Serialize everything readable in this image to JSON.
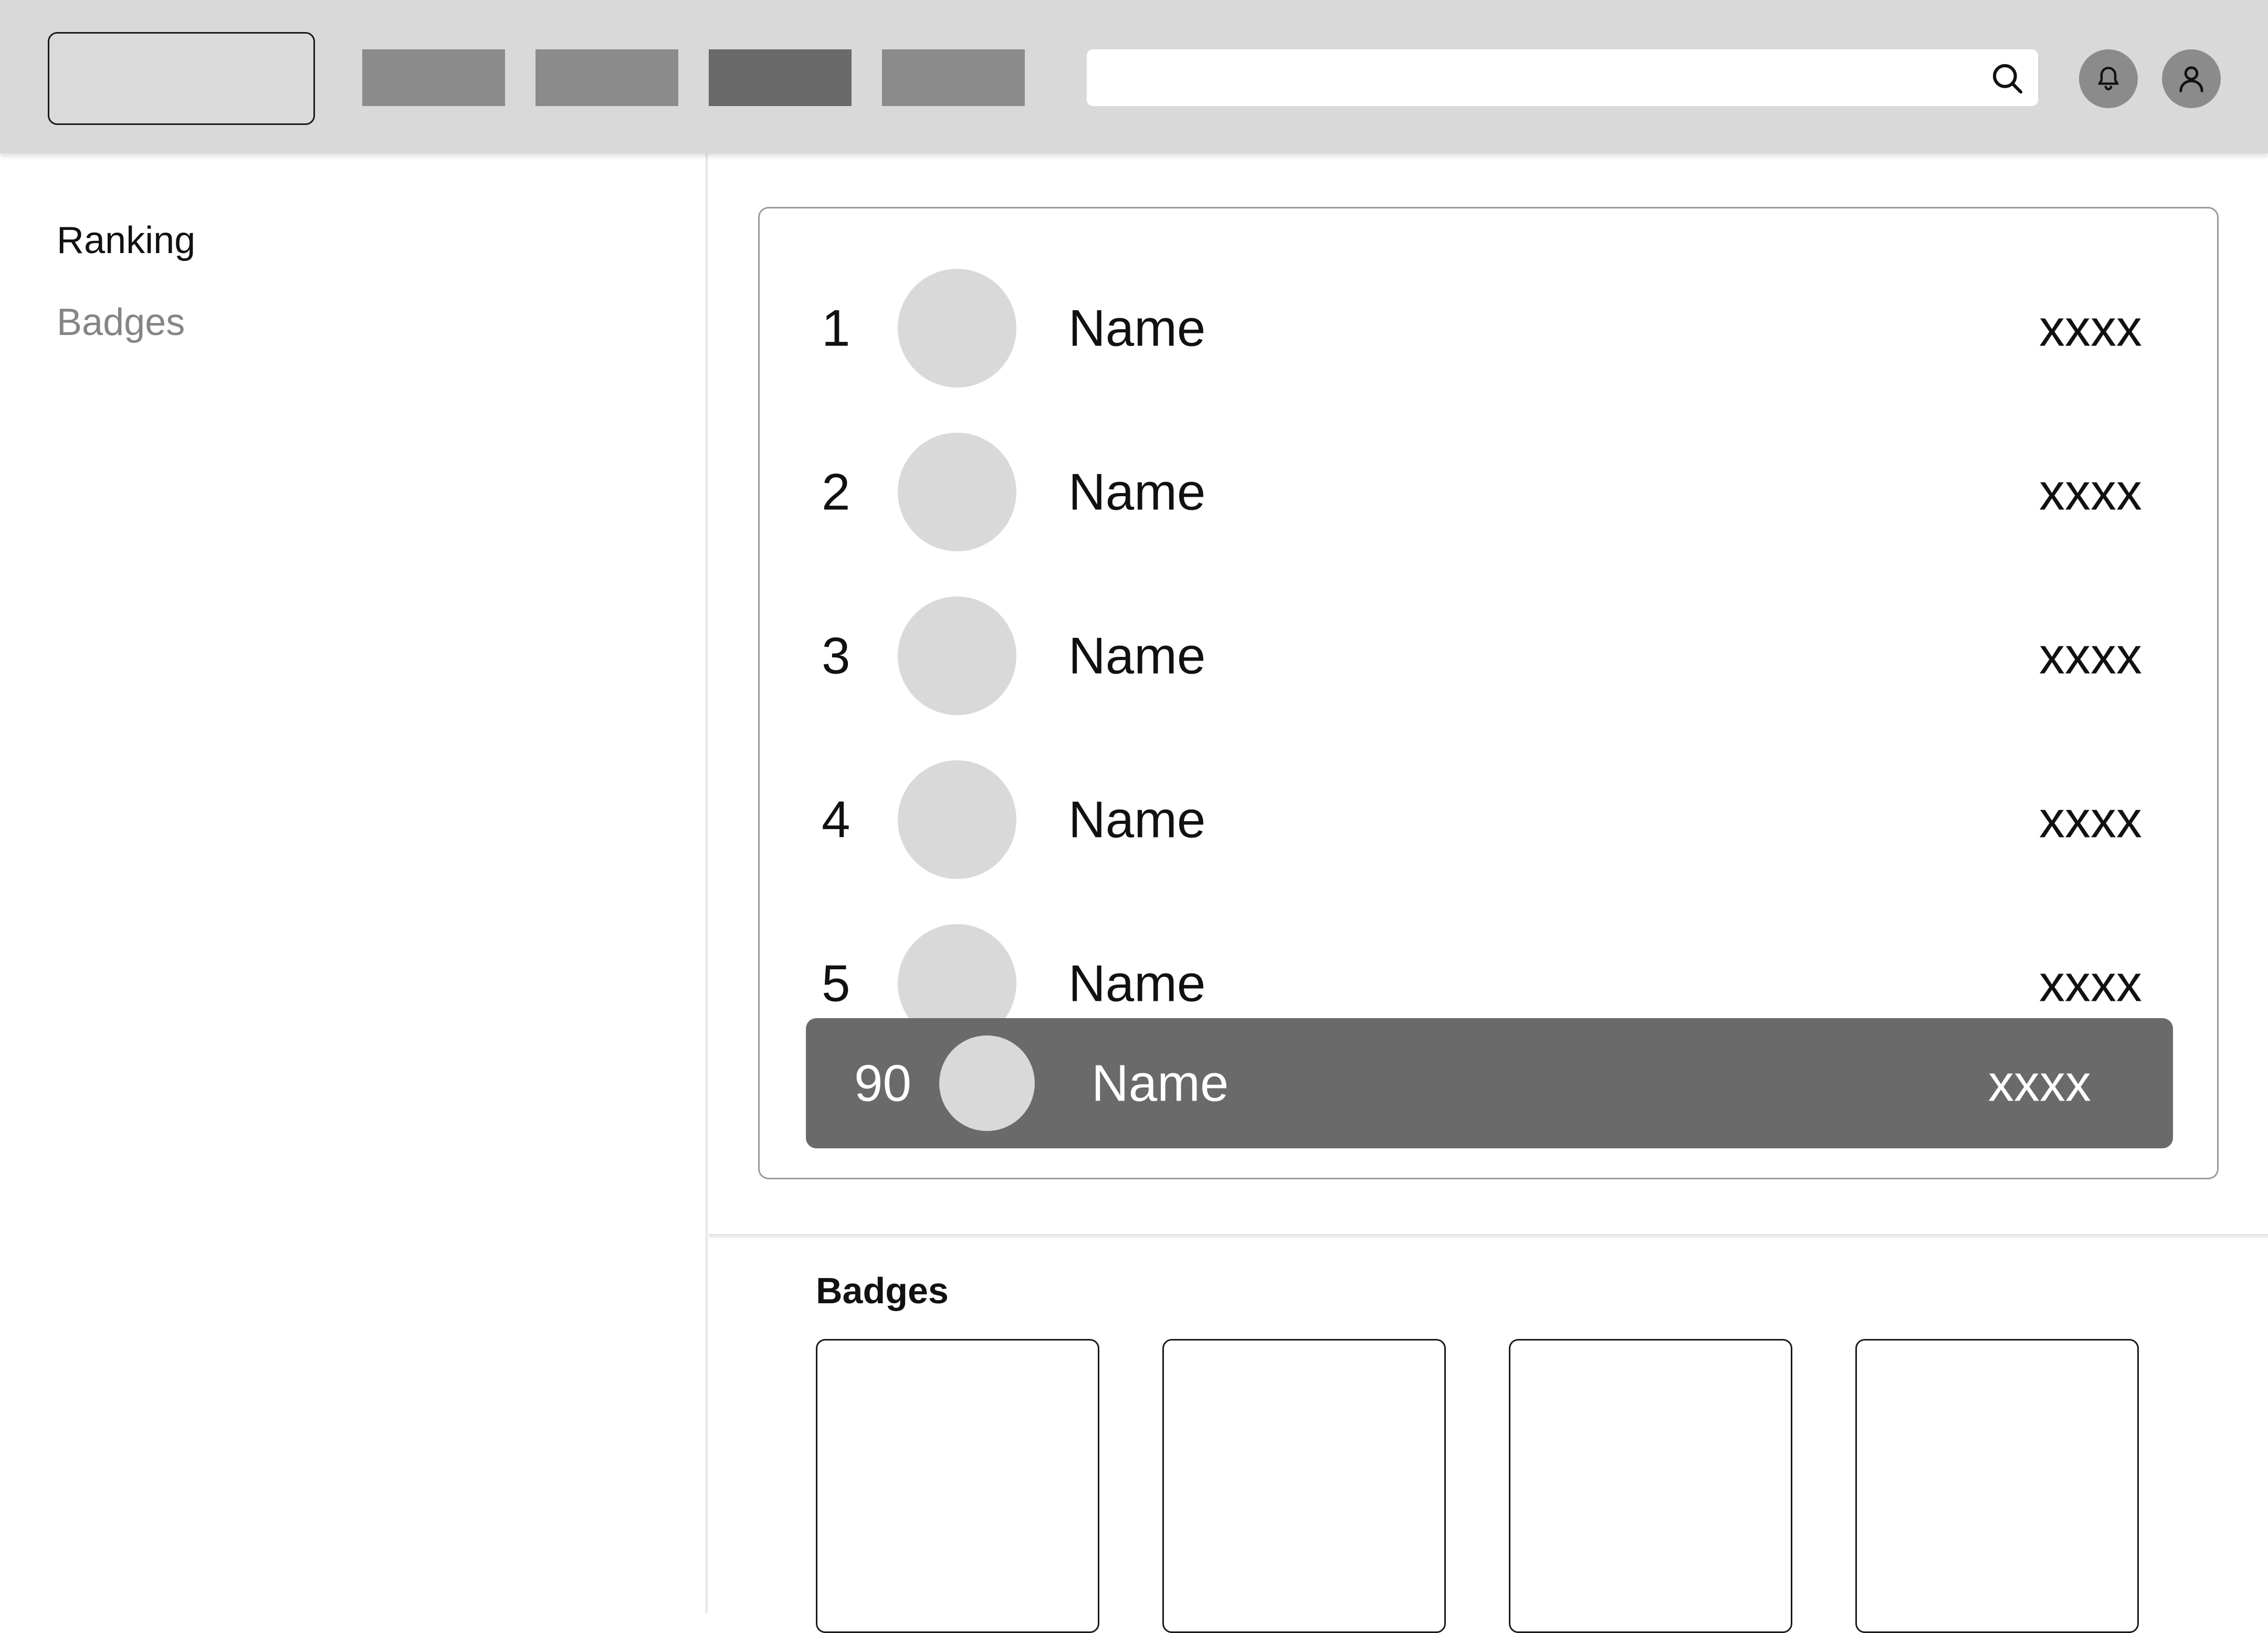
{
  "header": {
    "search": {
      "value": "",
      "placeholder": ""
    }
  },
  "sidebar": {
    "items": [
      {
        "label": "Ranking"
      },
      {
        "label": "Badges"
      }
    ]
  },
  "ranking": {
    "rows": [
      {
        "rank": "1",
        "name": "Name",
        "score": "xxxx"
      },
      {
        "rank": "2",
        "name": "Name",
        "score": "xxxx"
      },
      {
        "rank": "3",
        "name": "Name",
        "score": "xxxx"
      },
      {
        "rank": "4",
        "name": "Name",
        "score": "xxxx"
      },
      {
        "rank": "5",
        "name": "Name",
        "score": "xxxx"
      }
    ],
    "current_user": {
      "rank": "90",
      "name": "Name",
      "score": "xxxx"
    }
  },
  "badges": {
    "title": "Badges"
  },
  "icons": {
    "search": "search-icon",
    "notifications": "bell-icon",
    "profile": "user-icon"
  },
  "colors": {
    "topbar": "#d9d9d9",
    "nav_inactive": "#8c8b8b",
    "nav_active": "#6b6a6a",
    "highlight_row": "#6b6a6a",
    "avatar_placeholder": "#d9d9d9",
    "sidebar_inactive_text": "#858585"
  }
}
